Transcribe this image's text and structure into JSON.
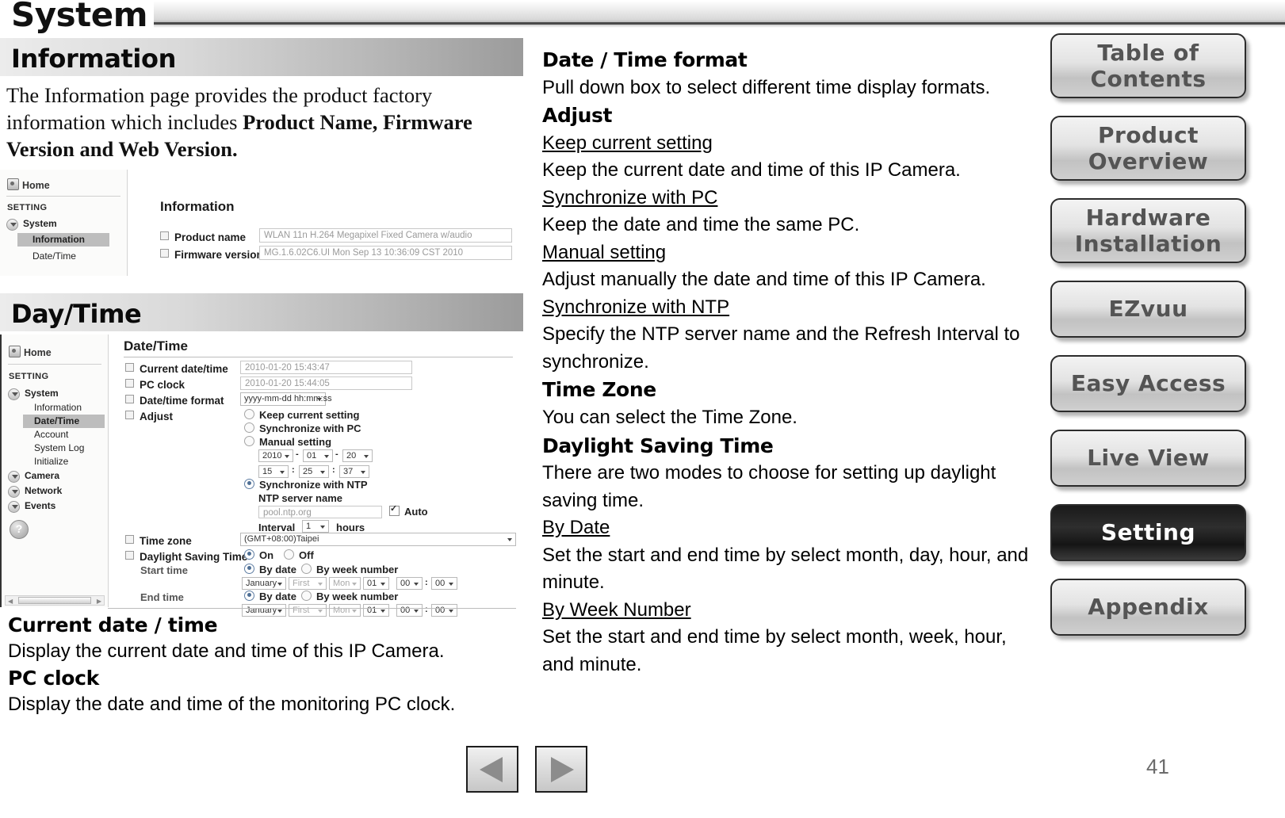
{
  "header": {
    "title": "System"
  },
  "page": {
    "number": "41"
  },
  "sections": {
    "information": {
      "band_label": "Information",
      "paragraph_1": "The Information page provides the product factory information which includes ",
      "paragraph_1_bold": "Product Name, Firmware Version and Web Version."
    },
    "daytime": {
      "band_label": "Day/Time"
    }
  },
  "info_screenshot": {
    "nav": {
      "home": "Home",
      "setting_label": "SETTING",
      "items": [
        {
          "label": "System",
          "level": "top"
        },
        {
          "label": "Information",
          "level": "sub",
          "selected": true
        },
        {
          "label": "Date/Time",
          "level": "sub",
          "selected": false
        }
      ]
    },
    "title": "Information",
    "fields": [
      {
        "label": "Product name",
        "value": "WLAN 11n H.264 Megapixel Fixed Camera w/audio"
      },
      {
        "label": "Firmware version",
        "value": "MG.1.6.02C6.UI    Mon Sep 13 10:36:09 CST 2010"
      }
    ]
  },
  "datetime_screenshot": {
    "nav": {
      "home": "Home",
      "setting_label": "SETTING",
      "items": [
        {
          "label": "System",
          "level": "top"
        },
        {
          "label": "Information",
          "level": "sub",
          "selected": false
        },
        {
          "label": "Date/Time",
          "level": "sub",
          "selected": true
        },
        {
          "label": "Account",
          "level": "sub",
          "selected": false
        },
        {
          "label": "System Log",
          "level": "sub",
          "selected": false
        },
        {
          "label": "Initialize",
          "level": "sub",
          "selected": false
        },
        {
          "label": "Camera",
          "level": "top"
        },
        {
          "label": "Network",
          "level": "top"
        },
        {
          "label": "Events",
          "level": "top"
        }
      ],
      "help_icon": "?"
    },
    "title": "Date/Time",
    "labels": {
      "current_datetime": "Current date/time",
      "pc_clock": "PC clock",
      "datetime_format": "Date/time format",
      "adjust": "Adjust",
      "time_zone": "Time zone",
      "dst": "Daylight Saving Time",
      "start_time": "Start time",
      "end_time": "End time",
      "ntp_server_name": "NTP server name",
      "interval": "Interval",
      "hours": "hours",
      "auto": "Auto"
    },
    "values": {
      "current_datetime": "2010-01-20   15:43:47",
      "pc_clock": "2010-01-20   15:44:05",
      "datetime_format": "yyyy-mm-dd hh:mm:ss",
      "manual_year": "2010",
      "manual_month": "01",
      "manual_day": "20",
      "manual_hour": "15",
      "manual_minute": "25",
      "manual_second": "37",
      "ntp_server": "pool.ntp.org",
      "interval_value": "1",
      "time_zone": "(GMT+08:00)Taipei",
      "start_month": "January",
      "start_week": "First",
      "start_weekday": "Mon",
      "start_day": "01",
      "start_hour": "00",
      "start_minute": "00",
      "end_month": "January",
      "end_week": "First",
      "end_weekday": "Mon",
      "end_day": "01",
      "end_hour": "00",
      "end_minute": "00"
    },
    "radios": {
      "keep_current": "Keep current setting",
      "sync_pc": "Synchronize with PC",
      "manual": "Manual setting",
      "sync_ntp": "Synchronize with NTP",
      "dst_on": "On",
      "dst_off": "Off",
      "by_date": "By date",
      "by_week": "By week number"
    }
  },
  "left_notes": [
    {
      "type": "h",
      "text": "Current date / time"
    },
    {
      "type": "p",
      "text": "Display the current date and time of this IP Camera."
    },
    {
      "type": "h",
      "text": "PC clock"
    },
    {
      "type": "p",
      "text": "Display the date and time of the monitoring PC clock."
    }
  ],
  "right_column": [
    {
      "type": "h",
      "text": " Date / Time format"
    },
    {
      "type": "p",
      "text": "Pull down box to select different time display formats."
    },
    {
      "type": "h",
      "text": "Adjust"
    },
    {
      "type": "u",
      "text": "Keep current setting"
    },
    {
      "type": "p",
      "text": "Keep the current date and time of this IP Camera."
    },
    {
      "type": "u",
      "text": "Synchronize with PC"
    },
    {
      "type": "p",
      "text": "Keep the date and time the same PC."
    },
    {
      "type": "u",
      "text": "Manual setting"
    },
    {
      "type": "p",
      "text": "Adjust manually the date and time of this IP Camera."
    },
    {
      "type": "u",
      "text": "Synchronize with NTP"
    },
    {
      "type": "p",
      "text": "Specify the NTP server name and the Refresh Interval to synchronize."
    },
    {
      "type": "h",
      "text": "Time Zone"
    },
    {
      "type": "p",
      "text": "You can select the Time Zone."
    },
    {
      "type": "h",
      "text": "Daylight Saving Time"
    },
    {
      "type": "p",
      "text": "There are two modes to choose for setting up daylight saving time."
    },
    {
      "type": "u",
      "text": "By Date"
    },
    {
      "type": "p",
      "text": "Set the start and end time by select month, day, hour, and minute."
    },
    {
      "type": "u",
      "text": "By Week Number"
    },
    {
      "type": "p",
      "text": "Set the start and end time by select month, week, hour, and minute."
    }
  ],
  "side_nav": [
    {
      "label": "Table of Contents",
      "lines": 2,
      "active": false
    },
    {
      "label": "Product Overview",
      "lines": 2,
      "active": false
    },
    {
      "label": "Hardware Installation",
      "lines": 2,
      "active": false
    },
    {
      "label": "EZvuu",
      "lines": 1,
      "active": false
    },
    {
      "label": "Easy Access",
      "lines": 1,
      "active": false
    },
    {
      "label": "Live View",
      "lines": 1,
      "active": false
    },
    {
      "label": "Setting",
      "lines": 1,
      "active": true
    },
    {
      "label": "Appendix",
      "lines": 1,
      "active": false
    }
  ],
  "footer_nav": [
    {
      "name": "previous-page-button",
      "icon": "triangle-left-icon"
    },
    {
      "name": "next-page-button",
      "icon": "triangle-right-icon"
    }
  ]
}
